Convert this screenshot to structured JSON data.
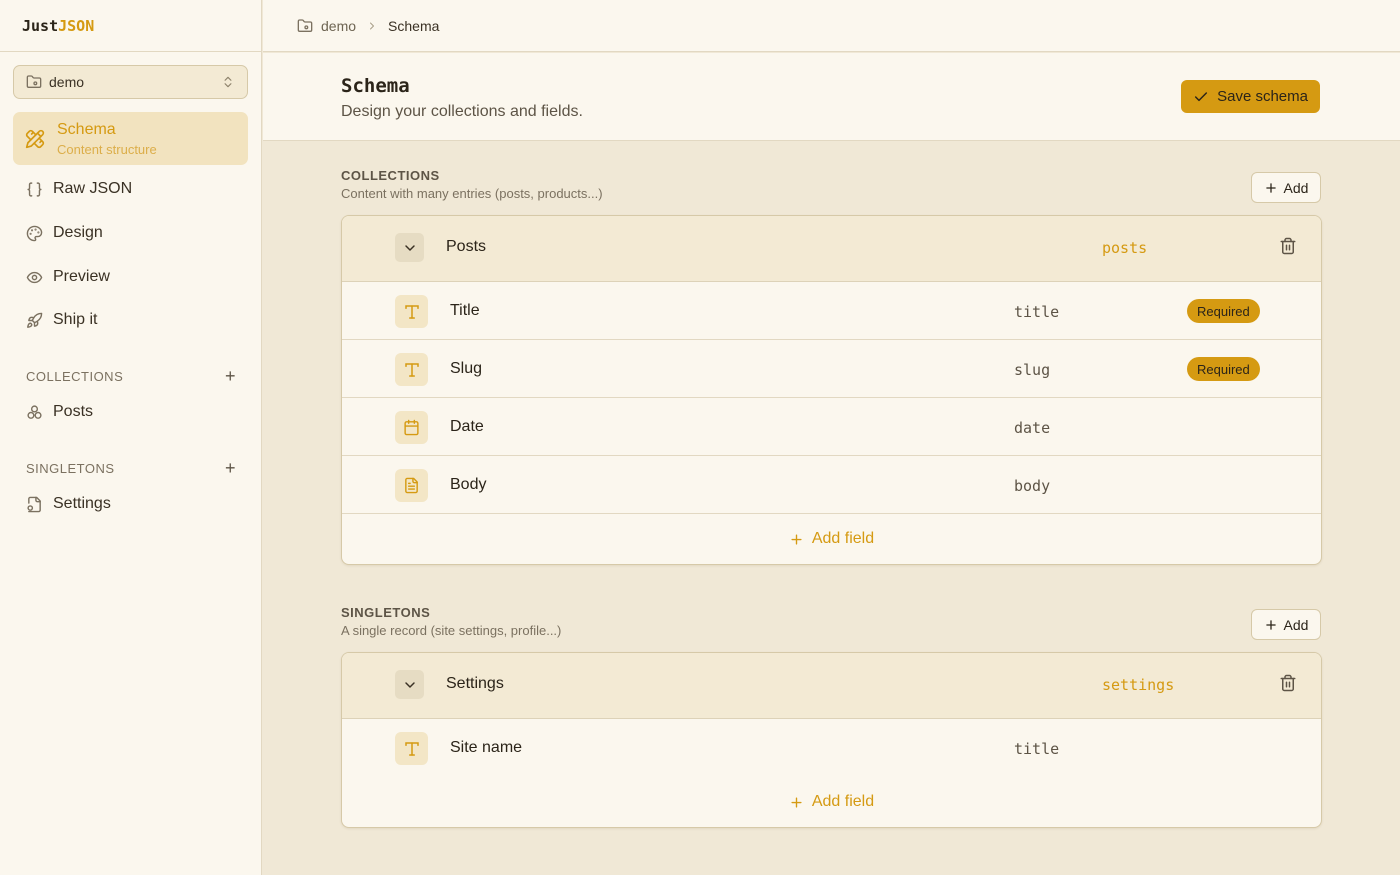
{
  "app": {
    "logo_part1": "Just",
    "logo_part2": "JSON"
  },
  "project": {
    "name": "demo"
  },
  "sidebar": {
    "active": {
      "label": "Schema",
      "sublabel": "Content structure"
    },
    "items": [
      {
        "label": "Raw JSON",
        "icon": "braces-icon"
      },
      {
        "label": "Design",
        "icon": "palette-icon"
      },
      {
        "label": "Preview",
        "icon": "eye-icon"
      },
      {
        "label": "Ship it",
        "icon": "rocket-icon"
      }
    ],
    "collections_label": "COLLECTIONS",
    "collections": [
      {
        "label": "Posts",
        "icon": "boxes-icon"
      }
    ],
    "singletons_label": "SINGLETONS",
    "singletons": [
      {
        "label": "Settings",
        "icon": "file-cog-icon"
      }
    ]
  },
  "breadcrumb": {
    "project": "demo",
    "current": "Schema"
  },
  "header": {
    "title": "Schema",
    "subtitle": "Design your collections and fields.",
    "save_label": "Save schema"
  },
  "collections_section": {
    "label": "COLLECTIONS",
    "description": "Content with many entries (posts, products...)",
    "add_label": "Add",
    "items": [
      {
        "name": "Posts",
        "key": "posts",
        "fields": [
          {
            "name": "Title",
            "key": "title",
            "type": "text",
            "required": "Required"
          },
          {
            "name": "Slug",
            "key": "slug",
            "type": "text",
            "required": "Required"
          },
          {
            "name": "Date",
            "key": "date",
            "type": "date",
            "required": ""
          },
          {
            "name": "Body",
            "key": "body",
            "type": "richtext",
            "required": ""
          }
        ],
        "add_field_label": "Add field"
      }
    ]
  },
  "singletons_section": {
    "label": "SINGLETONS",
    "description": "A single record (site settings, profile...)",
    "add_label": "Add",
    "items": [
      {
        "name": "Settings",
        "key": "settings",
        "fields": [
          {
            "name": "Site name",
            "key": "title",
            "type": "text",
            "required": ""
          }
        ],
        "add_field_label": "Add field"
      }
    ]
  },
  "colors": {
    "accent": "#d59a12",
    "background": "#f0e8d6",
    "surface": "#fbf7ee"
  }
}
